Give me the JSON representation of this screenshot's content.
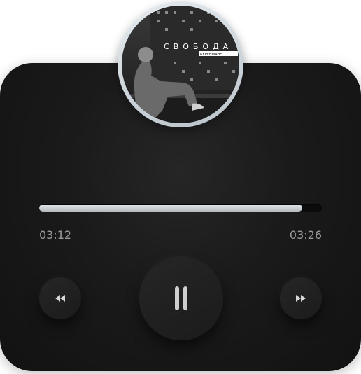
{
  "album": {
    "title": "СВОБОДА",
    "subtitle": "КЕРЕНМАНЕ"
  },
  "player": {
    "elapsed": "03:12",
    "duration": "03:26",
    "progress": 0.93,
    "state": "playing",
    "rewind_icon": "rewind-icon",
    "forward_icon": "fast-forward-icon",
    "pause_icon": "pause-icon"
  },
  "colors": {
    "card_bg": "#1a1a1a",
    "progress_fill": "#c9cfd2",
    "text_muted": "#9a9a9a",
    "ring": "#d7dfe4"
  }
}
